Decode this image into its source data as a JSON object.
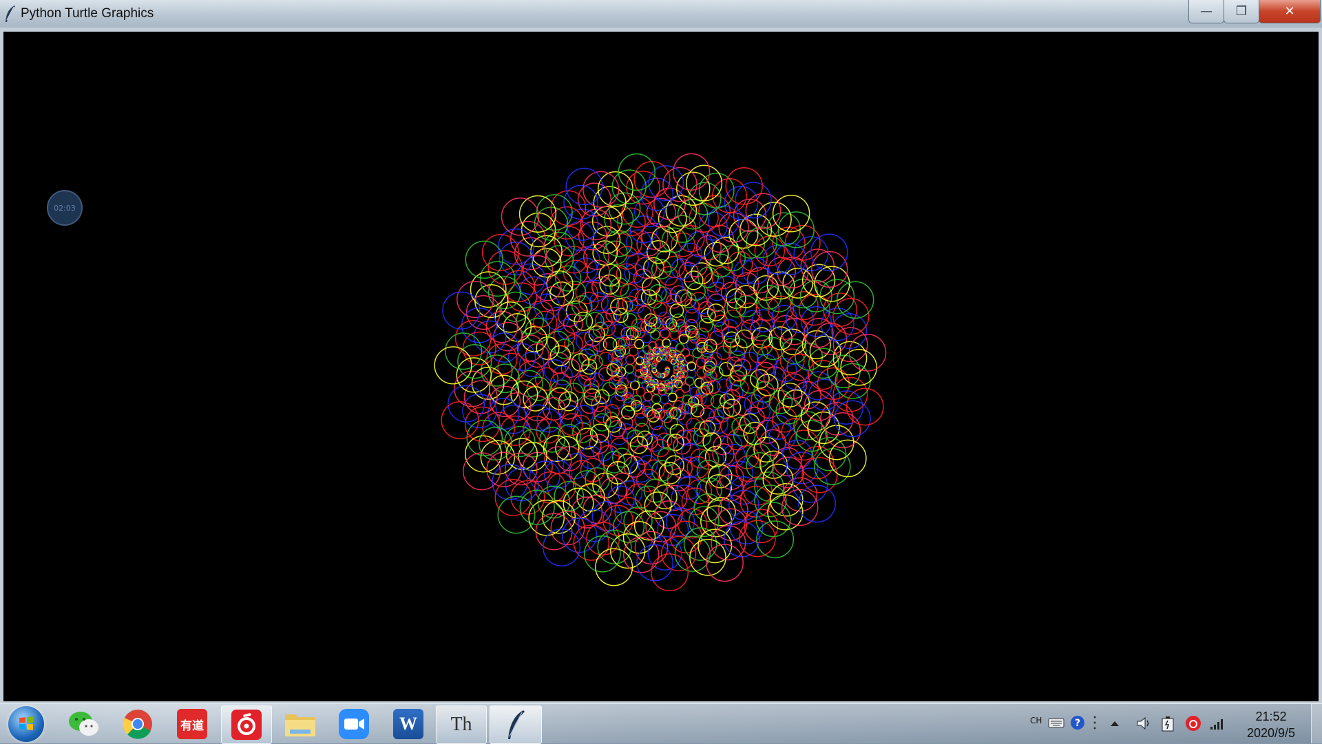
{
  "window": {
    "title": "Python Turtle Graphics",
    "controls": {
      "minimize": "—",
      "maximize": "❐",
      "close": "✕"
    }
  },
  "canvas": {
    "background": "#000000",
    "timer_badge": "02:03",
    "drawing_colors": [
      "#ff2020",
      "#ffff30",
      "#2030ff",
      "#30c030",
      "#ff3060"
    ]
  },
  "taskbar": {
    "apps": [
      {
        "name": "wechat",
        "label": ""
      },
      {
        "name": "chrome",
        "label": ""
      },
      {
        "name": "youdao",
        "label": "有道"
      },
      {
        "name": "netease-music",
        "label": ""
      },
      {
        "name": "file-explorer",
        "label": ""
      },
      {
        "name": "zoom",
        "label": ""
      },
      {
        "name": "word",
        "label": "W"
      },
      {
        "name": "typora",
        "label": "Th"
      },
      {
        "name": "python-turtle",
        "label": ""
      }
    ],
    "tray": {
      "input_method": "CH"
    },
    "clock": {
      "time": "21:52",
      "date": "2020/9/5"
    }
  }
}
